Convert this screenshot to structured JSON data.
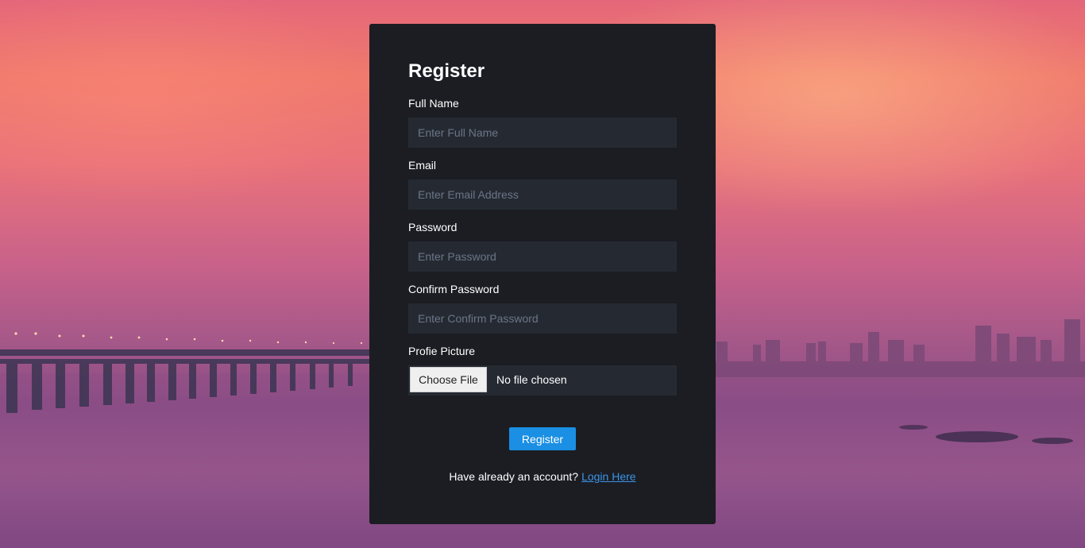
{
  "form": {
    "title": "Register",
    "fields": [
      {
        "label": "Full Name",
        "placeholder": "Enter Full Name",
        "type": "text"
      },
      {
        "label": "Email",
        "placeholder": "Enter Email Address",
        "type": "email"
      },
      {
        "label": "Password",
        "placeholder": "Enter Password",
        "type": "password"
      },
      {
        "label": "Confirm Password",
        "placeholder": "Enter Confirm Password",
        "type": "password"
      }
    ],
    "picture": {
      "label": "Profie Picture",
      "button_label": "Choose File",
      "status": "No file chosen"
    },
    "submit_label": "Register",
    "login_prompt": "Have already an account?",
    "login_link": "Login Here"
  },
  "colors": {
    "card": "#1b1d23",
    "input": "#252a32",
    "accent": "#1a8fe3",
    "link": "#3d93e6"
  }
}
